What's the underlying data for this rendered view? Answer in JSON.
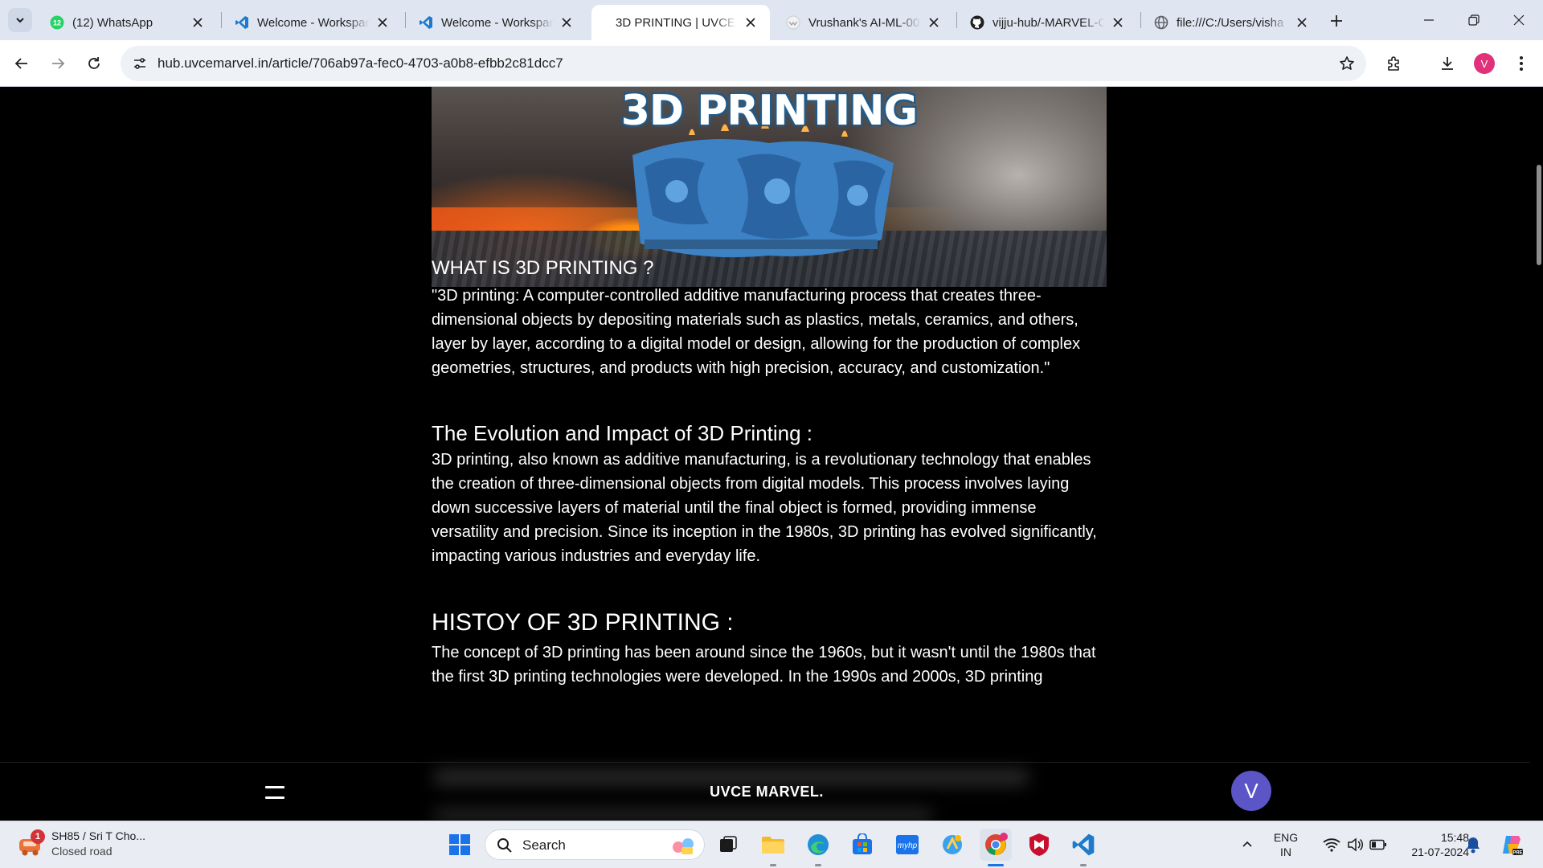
{
  "browser": {
    "tabs": [
      {
        "title": "(12) WhatsApp",
        "favicon": "whatsapp-icon",
        "badge": "12",
        "active": false
      },
      {
        "title": "Welcome - Workspace",
        "favicon": "vscode-icon",
        "active": false
      },
      {
        "title": "Welcome - Workspace",
        "favicon": "vscode-icon",
        "active": false
      },
      {
        "title": "3D PRINTING | UVCE",
        "favicon": "none",
        "active": true
      },
      {
        "title": "Vrushank's AI-ML-00",
        "favicon": "page-icon",
        "active": false
      },
      {
        "title": "vijju-hub/-MARVEL-C",
        "favicon": "github-icon",
        "active": false
      },
      {
        "title": "file:///C:/Users/visha",
        "favicon": "globe-icon",
        "active": false
      }
    ],
    "url": "hub.uvcemarvel.in/article/706ab97a-fec0-4703-a0b8-efbb2c81dcc7",
    "profile_initial": "V"
  },
  "article": {
    "hero_title": "3D PRINTING",
    "sections": [
      {
        "heading": "WHAT IS 3D PRINTING ?",
        "body": "\"3D printing: A computer-controlled additive manufacturing process that creates three-dimensional objects by depositing materials such as plastics, metals, ceramics, and others, layer by layer, according to a digital model or design, allowing for the production of complex geometries, structures, and products with high precision, accuracy, and customization.\""
      },
      {
        "heading": "The Evolution and Impact of 3D Printing :",
        "body": "3D printing, also known as additive manufacturing, is a revolutionary technology that enables the creation of three-dimensional objects from digital models. This process involves laying down successive layers of material until the final object is formed, providing immense versatility and precision. Since its inception in the 1980s, 3D printing has evolved significantly, impacting various industries and everyday life."
      },
      {
        "heading": "HISTOY OF 3D PRINTING :",
        "body": "The concept of 3D printing has been around since the 1960s, but it wasn't until the 1980s that the first 3D printing technologies were developed. In the 1990s and 2000s, 3D printing"
      }
    ]
  },
  "appbar": {
    "brand": "UVCE MARVEL.",
    "avatar_initial": "V"
  },
  "taskbar": {
    "weather_title": "SH85 / Sri T Cho...",
    "weather_sub": "Closed road",
    "weather_badge": "1",
    "search_label": "Search",
    "lang_top": "ENG",
    "lang_bottom": "IN",
    "time": "15:48",
    "date": "21-07-2024"
  },
  "colors": {
    "accent": "#1a73e8",
    "page_bg": "#000000",
    "app_avatar": "#5b55c7",
    "profile_avatar": "#e0317a"
  }
}
